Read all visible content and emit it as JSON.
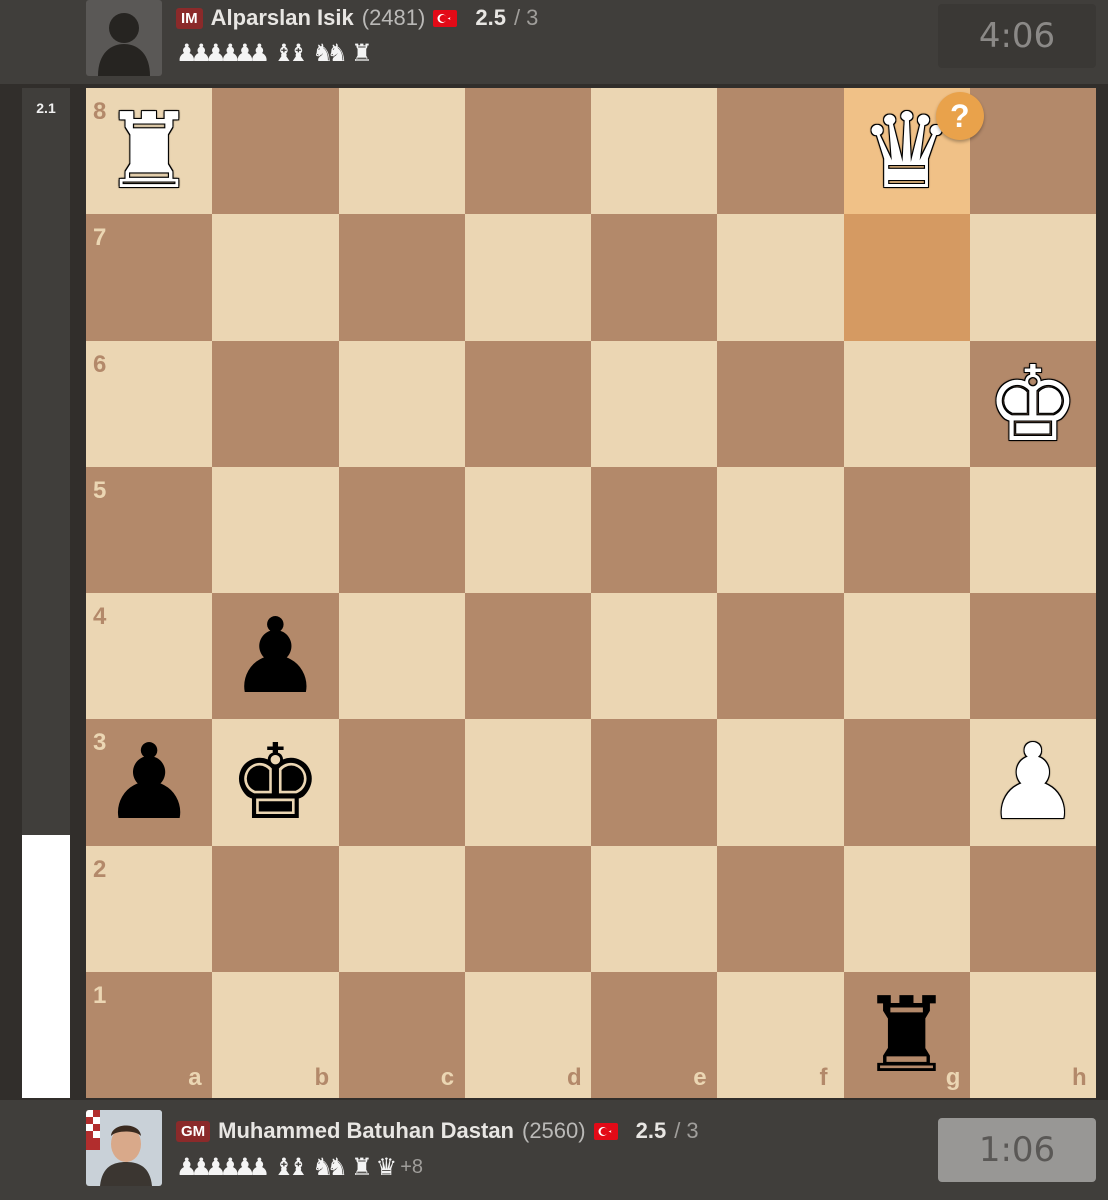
{
  "top_player": {
    "title": "IM",
    "name": "Alparslan Isik",
    "rating": "(2481)",
    "score": "2.5",
    "score_max": "/ 3",
    "clock": "4:06",
    "captured": {
      "pawns": "♟♟♟♟♟♟",
      "bishops": "♝♝",
      "knights": "♞♞",
      "rooks": "♜"
    },
    "flag": "turkey-flag"
  },
  "bottom_player": {
    "title": "GM",
    "name": "Muhammed Batuhan Dastan",
    "rating": "(2560)",
    "score": "2.5",
    "score_max": "/ 3",
    "clock": "1:06",
    "captured": {
      "pawns": "♟♟♟♟♟♟",
      "bishops": "♝♝",
      "knights": "♞♞",
      "rooks": "♜",
      "queens": "♛"
    },
    "advantage": "+8",
    "flag": "turkey-flag"
  },
  "eval": {
    "value": "2.1",
    "white_fraction": 0.26
  },
  "board": {
    "files": [
      "a",
      "b",
      "c",
      "d",
      "e",
      "f",
      "g",
      "h"
    ],
    "ranks": [
      "8",
      "7",
      "6",
      "5",
      "4",
      "3",
      "2",
      "1"
    ],
    "colors": {
      "light": "#ebd6b3",
      "dark": "#b3896a",
      "highlight_from": "#d59a62",
      "highlight_to": "#f0c187"
    },
    "pieces": [
      {
        "square": "a8",
        "color": "w",
        "type": "rook",
        "glyph": "♜"
      },
      {
        "square": "g8",
        "color": "w",
        "type": "queen",
        "glyph": "♛"
      },
      {
        "square": "h6",
        "color": "w",
        "type": "king",
        "glyph": "♚"
      },
      {
        "square": "h3",
        "color": "w",
        "type": "pawn",
        "glyph": "♟"
      },
      {
        "square": "b4",
        "color": "b",
        "type": "pawn",
        "glyph": "♟"
      },
      {
        "square": "a3",
        "color": "b",
        "type": "pawn",
        "glyph": "♟"
      },
      {
        "square": "b3",
        "color": "b",
        "type": "king",
        "glyph": "♚"
      },
      {
        "square": "g1",
        "color": "b",
        "type": "rook",
        "glyph": "♜"
      }
    ],
    "last_move": {
      "from": "g7",
      "to": "g8"
    },
    "move_annotation": {
      "square": "g8",
      "symbol": "?"
    }
  }
}
